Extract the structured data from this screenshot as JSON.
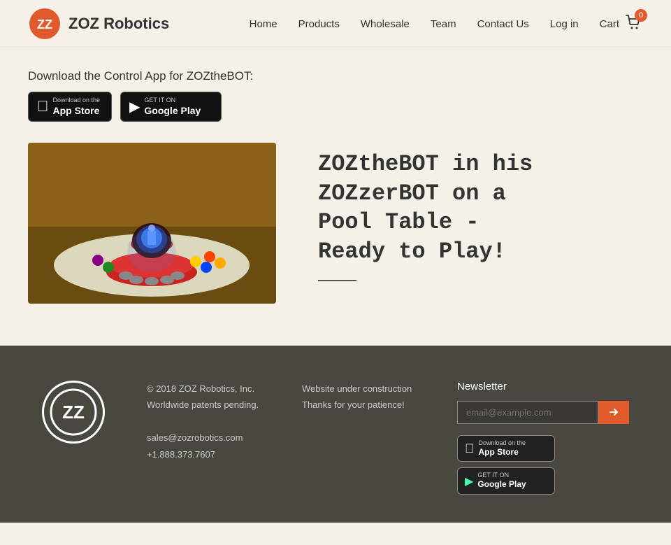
{
  "header": {
    "logo_text": "ZOZ Robotics",
    "nav": {
      "home": "Home",
      "products": "Products",
      "wholesale": "Wholesale",
      "team": "Team",
      "contact_us": "Contact Us",
      "log_in": "Log in",
      "cart": "Cart"
    },
    "cart_count": "0"
  },
  "main": {
    "download_title": "Download the Control App for ZOZtheBOT:",
    "app_store": {
      "sub": "Download on the",
      "main": "App Store"
    },
    "google_play": {
      "sub": "GET IT ON",
      "main": "Google Play"
    },
    "robot_title": "ZOZtheBOT in his ZOZzerBOT on a Pool Table - Ready to Play!",
    "robot_image_alt": "ZOZthebot robot on pool table"
  },
  "footer": {
    "copyright": "© 2018 ZOZ Robotics, Inc.",
    "patents": "Worldwide patents pending.",
    "email": "sales@zozrobotics.com",
    "phone": "+1.888.373.7607",
    "status_line1": "Website under construction",
    "status_line2": "Thanks for your patience!",
    "newsletter_title": "Newsletter",
    "newsletter_placeholder": "email@example.com",
    "app_store_sub": "Download on the",
    "app_store_main": "App Store",
    "google_play_sub": "GET IT ON",
    "google_play_main": "Google Play"
  },
  "colors": {
    "accent": "#e05a2b",
    "background": "#f5f0e8",
    "footer_bg": "#4a4741"
  }
}
